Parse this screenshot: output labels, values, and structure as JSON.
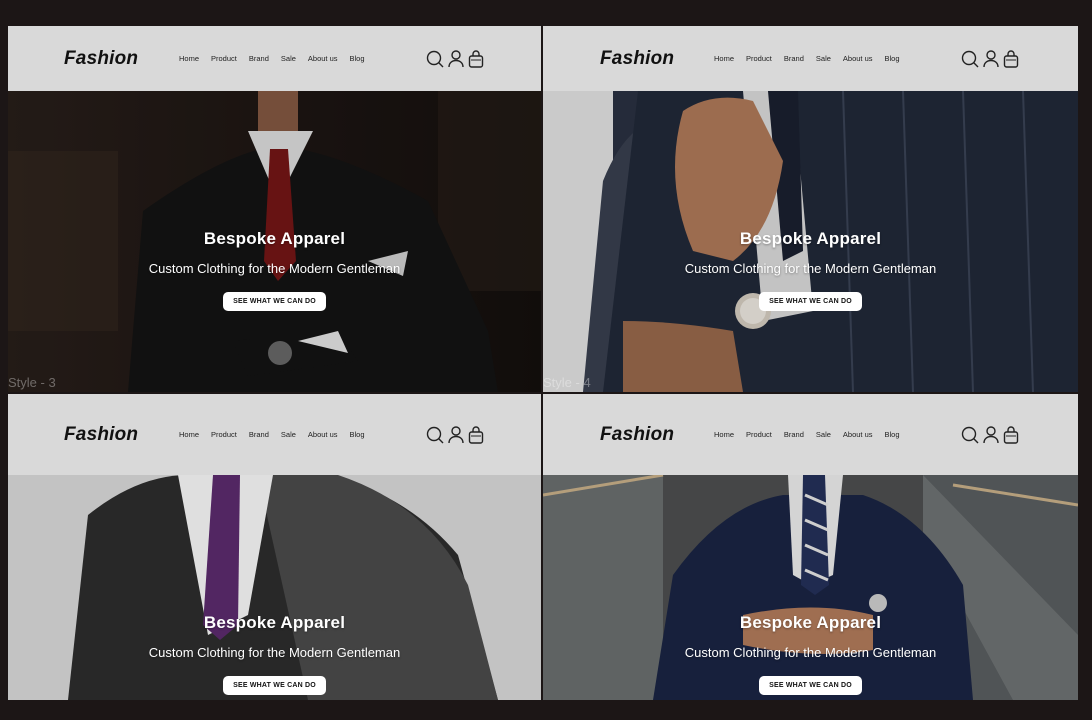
{
  "brand": {
    "logo": "Fashion"
  },
  "nav": {
    "items": [
      "Home",
      "Product",
      "Brand",
      "Sale",
      "About us",
      "Blog"
    ]
  },
  "icons": [
    "search-icon",
    "user-icon",
    "bag-icon"
  ],
  "hero": {
    "title": "Bespoke Apparel",
    "subtitle": "Custom Clothing for the Modern Gentleman",
    "cta": "SEE WHAT WE CAN DO"
  },
  "panels": [
    {
      "style_label": "Style - 3"
    },
    {
      "style_label": "Style - 4"
    },
    {
      "style_label": ""
    },
    {
      "style_label": ""
    }
  ],
  "colors": {
    "background": "#1c1616",
    "header": "#d9d9d9",
    "cta_bg": "#ffffff"
  }
}
